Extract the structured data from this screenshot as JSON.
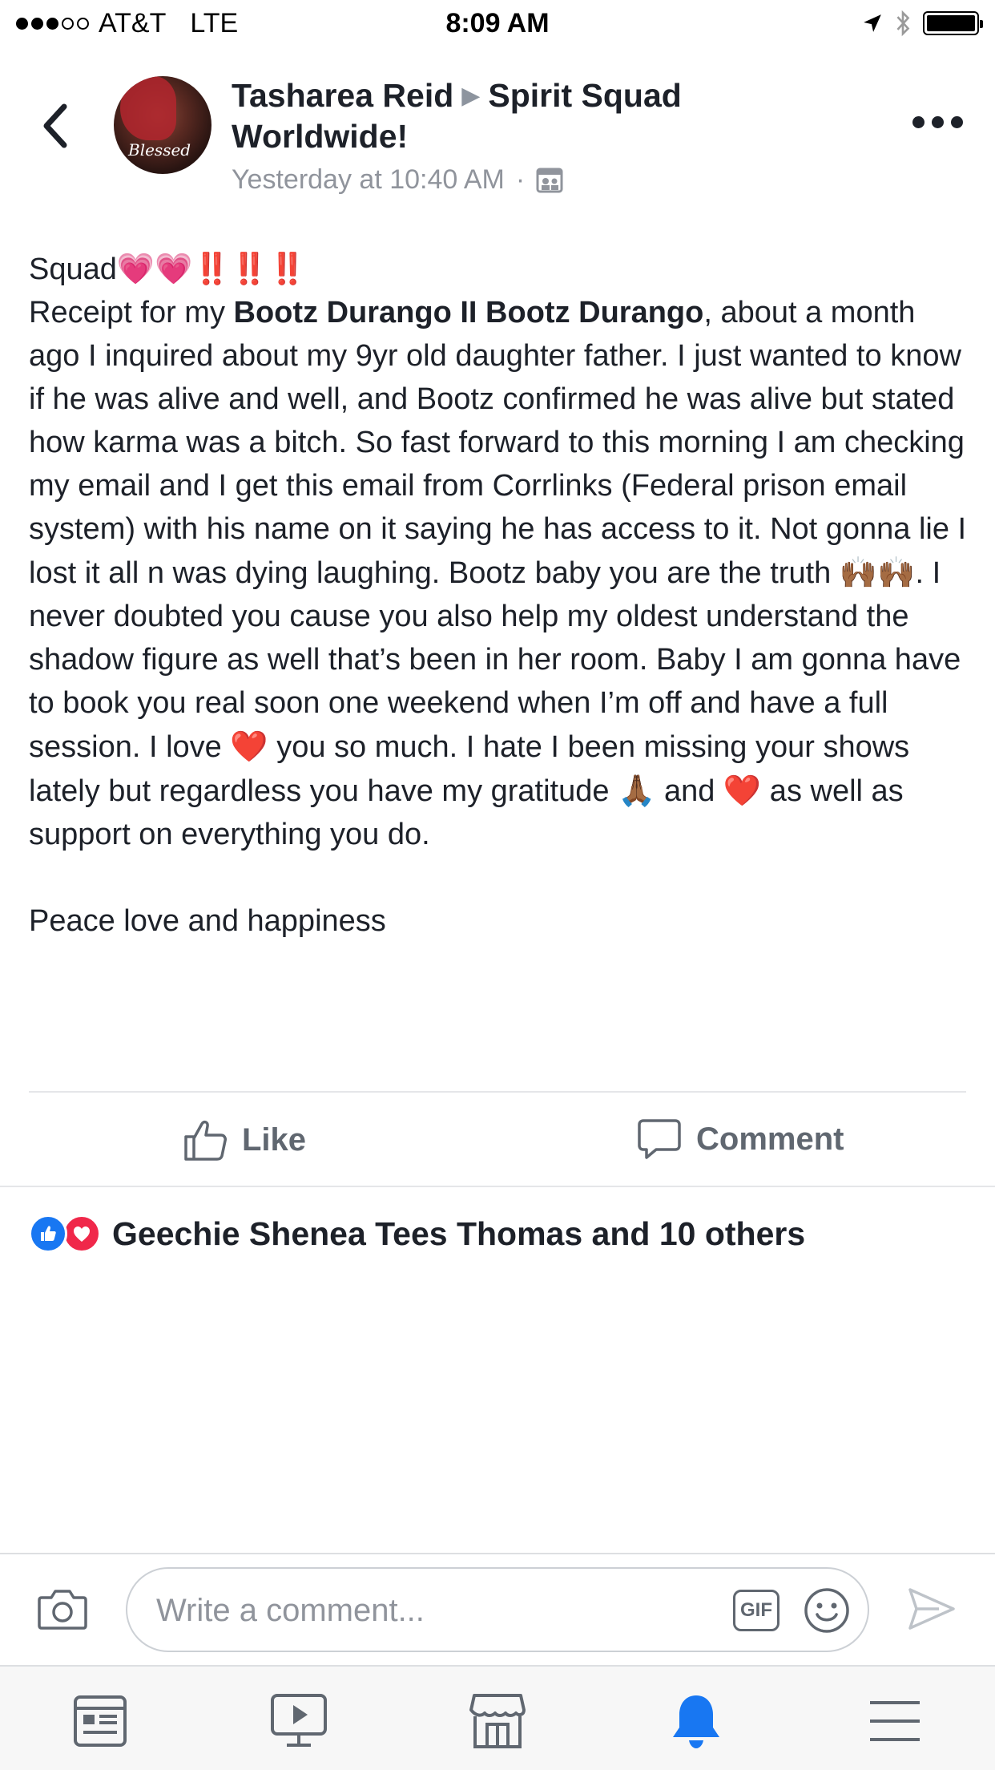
{
  "status_bar": {
    "carrier": "AT&T",
    "network": "LTE",
    "time": "8:09 AM",
    "signal_bars_filled": 3,
    "signal_bars_total": 5
  },
  "post": {
    "author": "Tasharea Reid",
    "group": "Spirit Squad Worldwide!",
    "timestamp": "Yesterday at 10:40 AM",
    "separator": "·",
    "avatar_caption": "Blessed",
    "body": {
      "p1_text": "Squad",
      "p1_emoji": "💗💗‼️‼️‼️",
      "p2_lead": "Receipt for my ",
      "p2_mention": "Bootz Durango II Bootz Durango",
      "p2_text_a": ", about a month ago I inquired about my 9yr old daughter father. I just wanted to know if he was alive and well, and Bootz confirmed he was alive but stated how karma was a bitch. So fast forward to this morning I am checking my email and I get this email from Corrlinks (Federal prison email system) with his name on it saying he has access to it. Not gonna lie I lost it all n was dying laughing. Bootz baby you are the truth ",
      "p2_emoji_hands": "🙌🏾🙌🏾",
      "p2_text_b": ". I never doubted you cause you also help my oldest understand the shadow figure as well that’s been in her room. Baby I am gonna have to book you real soon one weekend when I’m off and have a full session. I love ",
      "p2_emoji_heart1": "❤️",
      "p2_text_c": " you so much. I hate I been missing your shows lately but regardless you have my gratitude ",
      "p2_emoji_pray": "🙏🏾",
      "p2_text_d": " and ",
      "p2_emoji_heart2": "❤️",
      "p2_text_e": " as well as support on everything you do.",
      "p3_text": "Peace love and happiness"
    },
    "actions": {
      "like_label": "Like",
      "comment_label": "Comment"
    },
    "reactions": {
      "summary": "Geechie Shenea Tees Thomas and 10 others"
    }
  },
  "composer": {
    "placeholder": "Write a comment...",
    "gif_label": "GIF"
  },
  "tabbar": {
    "items": [
      "news-feed",
      "watch",
      "marketplace",
      "notifications",
      "menu"
    ],
    "active": "notifications"
  },
  "colors": {
    "text": "#1d2129",
    "meta": "#90949c",
    "action": "#606770",
    "active_tab": "#1877f2",
    "like_reaction": "#1877f2",
    "love_reaction": "#f0284a"
  }
}
